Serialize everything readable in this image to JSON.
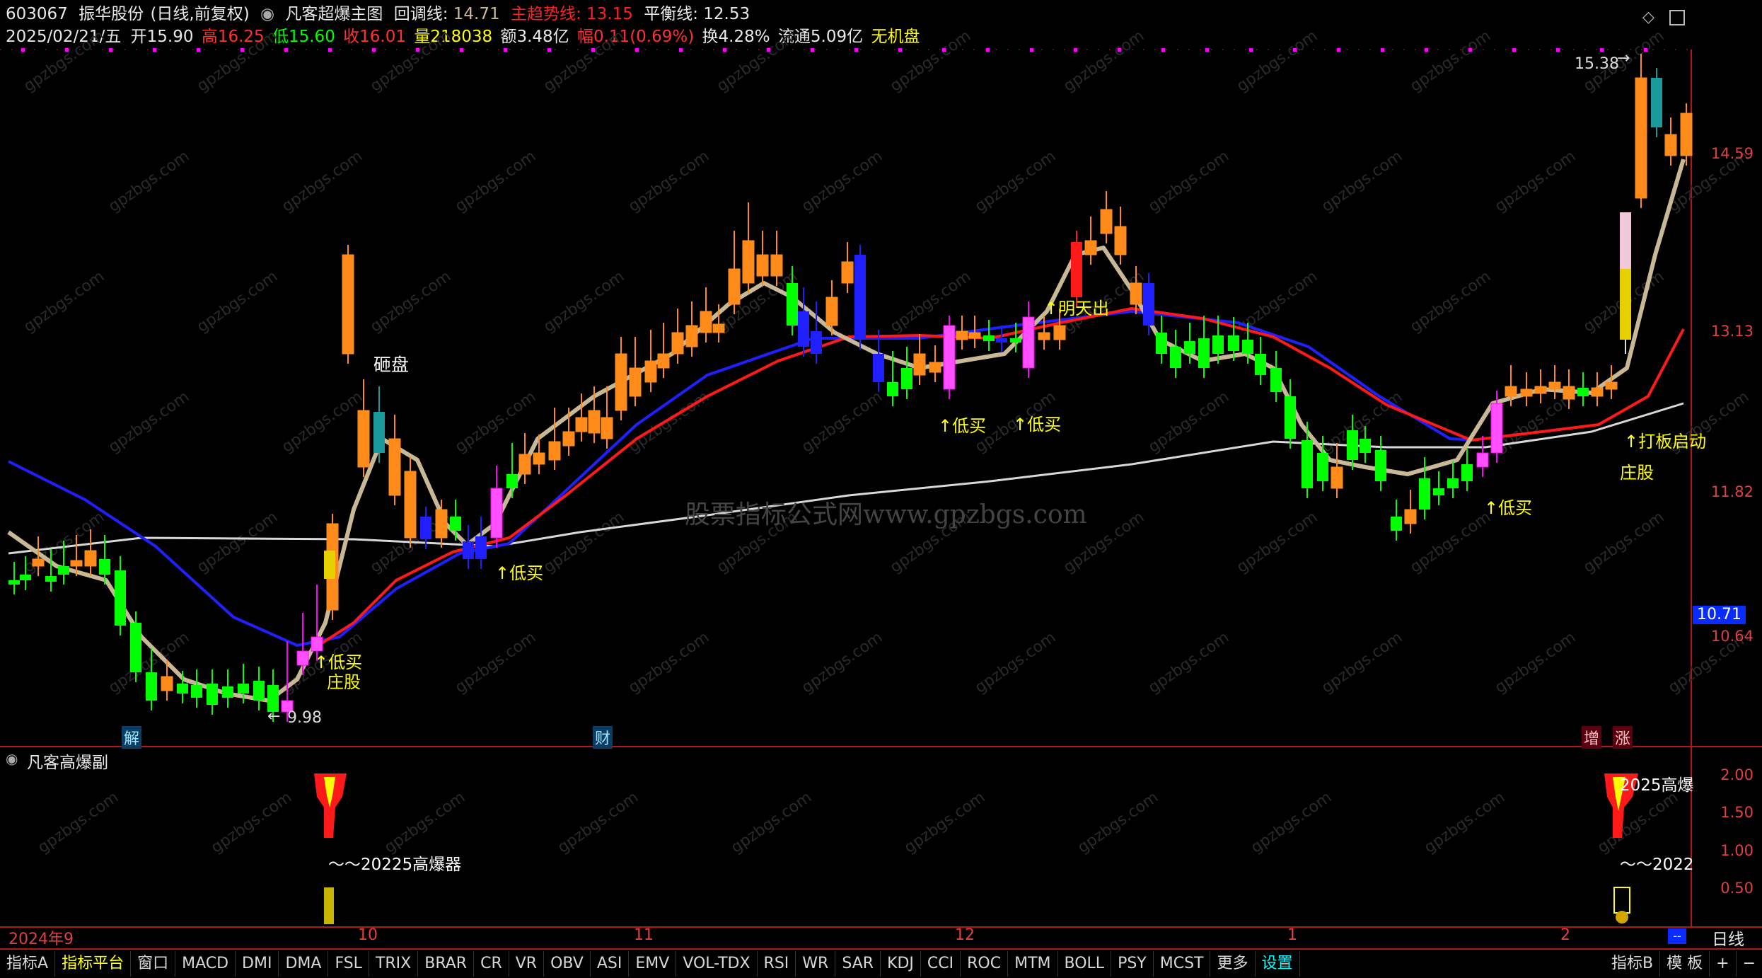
{
  "header": {
    "code": "603067",
    "name": "振华股份",
    "period": "(日线,前复权)",
    "indicator": "凡客超爆主图",
    "huitiao_label": "回调线:",
    "huitiao_value": "14.71",
    "zhuqushi_label": "主趋势线:",
    "zhuqushi_value": "13.15",
    "pingheng_label": "平衡线:",
    "pingheng_value": "12.53"
  },
  "quote": {
    "date": "2025/02/21/五",
    "open": "开15.90",
    "high": "高16.25",
    "low": "低15.60",
    "close": "收16.01",
    "volume": "量218038",
    "amount": "额3.48亿",
    "change": "幅0.11(0.69%)",
    "turnover": "换4.28%",
    "float": "流通5.09亿",
    "status": "无机盘"
  },
  "price_axis": [
    "14.59",
    "13.13",
    "11.82",
    "10.64"
  ],
  "current_price_tag": "10.71",
  "sub_axis": [
    "2.00",
    "1.50",
    "1.00",
    "0.50"
  ],
  "sub_title": "凡客高爆副",
  "annotations": {
    "high_price": "15.38",
    "low_price": "9.98",
    "za_pan": "砸盘",
    "di_mai": "↑低买",
    "zhuang_gu": "庄股",
    "ming_tian_chu": "↑明天出",
    "da_ban": "↑打板启动",
    "jie": "解",
    "cai": "财",
    "zeng": "增",
    "zhang": "涨",
    "sub_label_1": "～～20225高爆器",
    "sub_label_2": "2025高爆",
    "sub_label_3": "～～2022",
    "watermark_center": "股票指标公式网www.gpzbgs.com",
    "watermark_small": "gpzbgs.com"
  },
  "date_axis": [
    "2024年9",
    "10",
    "11",
    "12",
    "1",
    "2"
  ],
  "period_label": "日线",
  "tabs": [
    "指标A",
    "指标平台",
    "窗口",
    "MACD",
    "DMI",
    "DMA",
    "FSL",
    "TRIX",
    "BRAR",
    "CR",
    "VR",
    "OBV",
    "ASI",
    "EMV",
    "VOL-TDX",
    "RSI",
    "WR",
    "SAR",
    "KDJ",
    "CCI",
    "ROC",
    "MTM",
    "BOLL",
    "PSY",
    "MCST",
    "更多",
    "设置"
  ],
  "right_tabs": [
    "指标B",
    "模 板",
    "+",
    "−"
  ],
  "colors": {
    "up": "#ff8c1a",
    "down": "#00ff00",
    "blue": "#0000ff",
    "magenta": "#ff00ff",
    "red_line": "#ff1a1a",
    "blue_line": "#2020ff",
    "tan_line": "#c8b896",
    "white_line": "#d8d8d8"
  }
}
